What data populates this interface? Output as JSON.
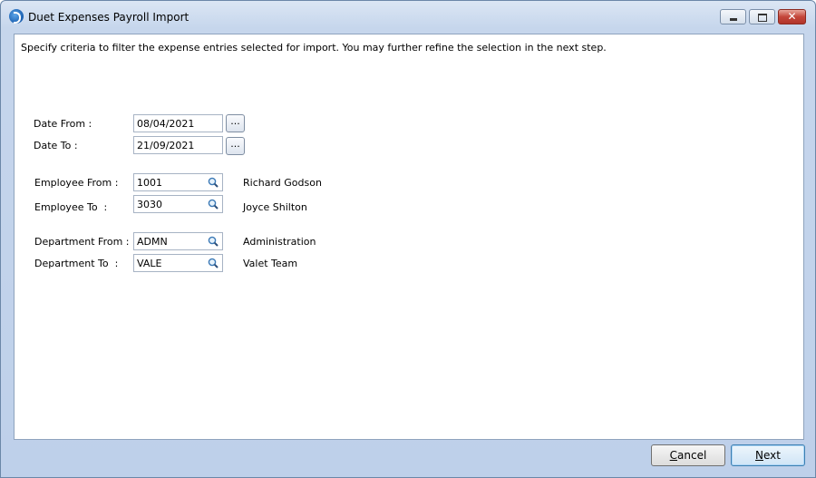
{
  "window": {
    "title": "Duet Expenses Payroll Import",
    "icon": "duet-app-icon"
  },
  "instructions": "Specify criteria to filter the expense entries selected for import. You may further refine the selection in the next step.",
  "criteria": {
    "date_from": {
      "label": "Date From :",
      "value": "08/04/2021",
      "picker": "..."
    },
    "date_to": {
      "label": "Date To :",
      "value": "21/09/2021",
      "picker": "..."
    },
    "employee_from": {
      "label": "Employee From :",
      "value": "1001",
      "description": "Richard Godson"
    },
    "employee_to": {
      "label": "Employee To  :",
      "value": "3030",
      "description": "Joyce Shilton"
    },
    "department_from": {
      "label": "Department From :",
      "value": "ADMN",
      "description": "Administration"
    },
    "department_to": {
      "label": "Department To  :",
      "value": "VALE",
      "description": "Valet Team"
    }
  },
  "buttons": {
    "cancel_first": "C",
    "cancel_rest": "ancel",
    "next_first": "N",
    "next_rest": "ext"
  }
}
